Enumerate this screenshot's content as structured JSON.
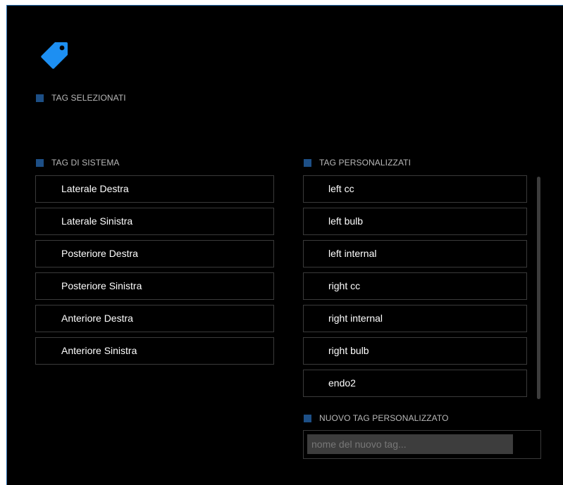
{
  "logo_icon": "tag-icon",
  "accent_color": "#1d8ff2",
  "selected_tags": {
    "label": "TAG SELEZIONATI",
    "items": []
  },
  "system_tags": {
    "label": "TAG DI SISTEMA",
    "items": [
      {
        "label": "Laterale Destra"
      },
      {
        "label": "Laterale Sinistra"
      },
      {
        "label": "Posteriore Destra"
      },
      {
        "label": "Posteriore Sinistra"
      },
      {
        "label": "Anteriore Destra"
      },
      {
        "label": "Anteriore Sinistra"
      }
    ]
  },
  "custom_tags": {
    "label": "TAG PERSONALIZZATI",
    "items": [
      {
        "label": "left cc"
      },
      {
        "label": "left bulb"
      },
      {
        "label": "left internal"
      },
      {
        "label": "right cc"
      },
      {
        "label": "right internal"
      },
      {
        "label": "right bulb"
      },
      {
        "label": "endo2"
      }
    ]
  },
  "new_custom_tag": {
    "label": "NUOVO TAG PERSONALIZZATO",
    "value": "",
    "placeholder": "nome del nuovo tag..."
  }
}
